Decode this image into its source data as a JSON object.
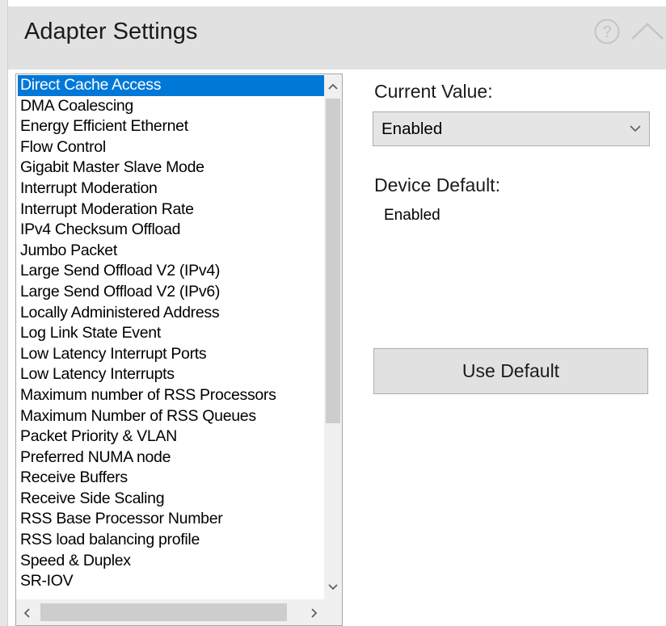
{
  "header": {
    "title": "Adapter Settings"
  },
  "icons": {
    "help": "question-circle-icon",
    "collapse": "chevron-up-icon"
  },
  "settings_list": {
    "selected_index": 0,
    "items": [
      "Direct Cache Access",
      "DMA Coalescing",
      "Energy Efficient Ethernet",
      "Flow Control",
      "Gigabit Master Slave Mode",
      "Interrupt Moderation",
      "Interrupt Moderation Rate",
      "IPv4 Checksum Offload",
      "Jumbo Packet",
      "Large Send Offload V2 (IPv4)",
      "Large Send Offload V2 (IPv6)",
      "Locally Administered Address",
      "Log Link State Event",
      "Low Latency Interrupt Ports",
      "Low Latency Interrupts",
      "Maximum number of RSS Processors",
      "Maximum Number of RSS Queues",
      "Packet Priority & VLAN",
      "Preferred NUMA node",
      "Receive Buffers",
      "Receive Side Scaling",
      "RSS Base Processor Number",
      "RSS load balancing profile",
      "Speed & Duplex",
      "SR-IOV"
    ]
  },
  "current_value": {
    "label": "Current Value:",
    "selected": "Enabled"
  },
  "device_default": {
    "label": "Device Default:",
    "value": "Enabled"
  },
  "use_default_button": {
    "label": "Use Default"
  },
  "colors": {
    "selection": "#0078d7",
    "header_bg": "#e1e1e1",
    "button_bg": "#e1e1e1"
  }
}
